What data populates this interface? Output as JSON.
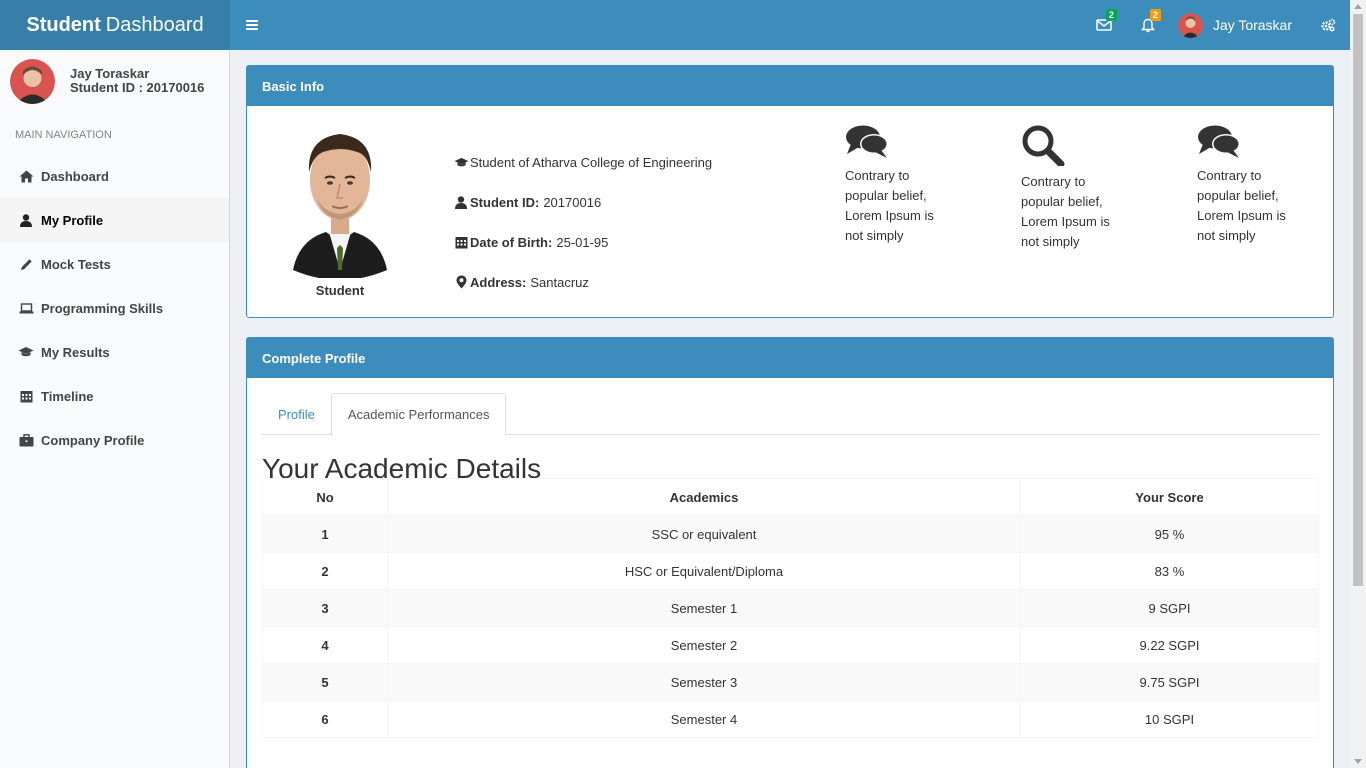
{
  "header": {
    "logo_bold": "Student",
    "logo_rest": "Dashboard",
    "mail_count": "2",
    "notif_count": "2",
    "user_name": "Jay Toraskar"
  },
  "sidebar": {
    "user_name": "Jay Toraskar",
    "student_id": "Student ID : 20170016",
    "nav_header": "MAIN NAVIGATION",
    "items": [
      {
        "label": "Dashboard",
        "icon": "home-icon"
      },
      {
        "label": "My Profile",
        "icon": "user-icon",
        "active": true
      },
      {
        "label": "Mock Tests",
        "icon": "pencil-icon"
      },
      {
        "label": "Programming Skills",
        "icon": "laptop-icon"
      },
      {
        "label": "My Results",
        "icon": "graduation-cap-icon"
      },
      {
        "label": "Timeline",
        "icon": "calendar-icon"
      },
      {
        "label": "Company Profile",
        "icon": "briefcase-icon"
      }
    ]
  },
  "basic_info": {
    "title": "Basic Info",
    "photo_caption": "Student",
    "college": "Student of Atharva College of Engineering",
    "student_id_label": "Student ID:",
    "student_id": "20170016",
    "dob_label": "Date of Birth:",
    "dob": "25-01-95",
    "address_label": "Address:",
    "address": "Santacruz",
    "features": [
      {
        "icon": "comments-icon",
        "line1": "Contrary to",
        "line2": "popular belief,",
        "line3": "Lorem Ipsum is",
        "line4": "not simply"
      },
      {
        "icon": "search-icon",
        "line1": "Contrary to",
        "line2": "popular belief,",
        "line3": "Lorem Ipsum is",
        "line4": "not simply"
      },
      {
        "icon": "comments-icon",
        "line1": "Contrary to",
        "line2": "popular belief,",
        "line3": "Lorem Ipsum is",
        "line4": "not simply"
      }
    ]
  },
  "complete_profile": {
    "title": "Complete Profile",
    "tabs": [
      "Profile",
      "Academic Performances"
    ],
    "active_tab": "Academic Performances",
    "section_title": "Your Academic Details",
    "columns": [
      "No",
      "Academics",
      "Your Score"
    ],
    "rows": [
      [
        "1",
        "SSC or equivalent",
        "95 %"
      ],
      [
        "2",
        "HSC or Equivalent/Diploma",
        "83 %"
      ],
      [
        "3",
        "Semester 1",
        "9 SGPI"
      ],
      [
        "4",
        "Semester 2",
        "9.22 SGPI"
      ],
      [
        "5",
        "Semester 3",
        "9.75 SGPI"
      ],
      [
        "6",
        "Semester 4",
        "10 SGPI"
      ]
    ]
  },
  "colors": {
    "primary": "#3c8dbc",
    "primary_dark": "#367fa9",
    "badge_green": "#00a65a",
    "badge_orange": "#f39c12"
  }
}
